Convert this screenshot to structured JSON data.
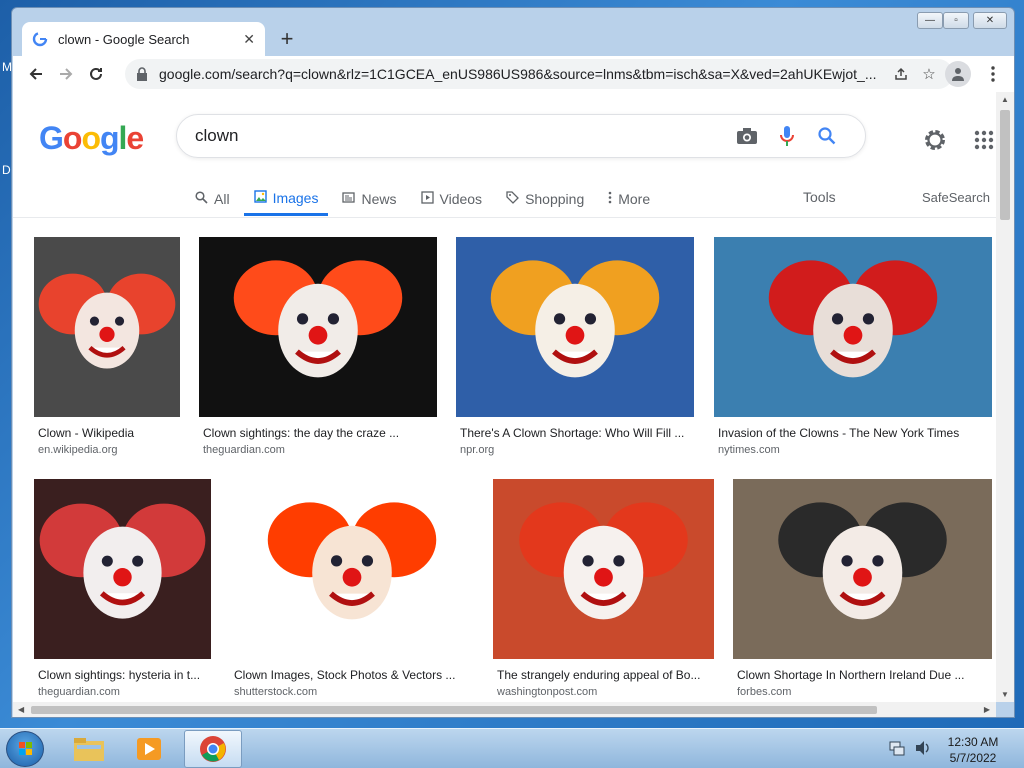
{
  "desktop": {
    "left_labels": [
      "M",
      "D"
    ]
  },
  "browser": {
    "window_controls": {
      "minimize": "—",
      "maximize": "▫",
      "close": "✕"
    },
    "tab": {
      "title": "clown - Google Search",
      "close": "✕"
    },
    "new_tab": "+",
    "url": "google.com/search?q=clown&rlz=1C1GCEA_enUS986US986&source=lnms&tbm=isch&sa=X&ved=2ahUKEwjot_..."
  },
  "google": {
    "logo": [
      {
        "ch": "G",
        "color": "#4285F4"
      },
      {
        "ch": "o",
        "color": "#EA4335"
      },
      {
        "ch": "o",
        "color": "#FBBC05"
      },
      {
        "ch": "g",
        "color": "#4285F4"
      },
      {
        "ch": "l",
        "color": "#34A853"
      },
      {
        "ch": "e",
        "color": "#EA4335"
      }
    ],
    "query": "clown",
    "tabs": [
      {
        "label": "All",
        "icon": "search-icon",
        "active": false
      },
      {
        "label": "Images",
        "icon": "image-icon",
        "active": true
      },
      {
        "label": "News",
        "icon": "news-icon",
        "active": false
      },
      {
        "label": "Videos",
        "icon": "video-icon",
        "active": false
      },
      {
        "label": "Shopping",
        "icon": "tag-icon",
        "active": false
      },
      {
        "label": "More",
        "icon": "more-vert-icon",
        "active": false
      }
    ],
    "tools": "Tools",
    "safesearch": "SafeSearch"
  },
  "results": [
    {
      "caption": "Clown - Wikipedia",
      "source": "en.wikipedia.org",
      "bg": "#4a4a4a",
      "face": "#f3e6e0",
      "hair": "#e8432d"
    },
    {
      "caption": "Clown sightings: the day the craze ...",
      "source": "theguardian.com",
      "bg": "#111111",
      "face": "#f1ece8",
      "hair": "#ff4b1a"
    },
    {
      "caption": "There's A Clown Shortage: Who Will Fill ...",
      "source": "npr.org",
      "bg": "#2f5fa8",
      "face": "#f5efe6",
      "hair": "#f0a020"
    },
    {
      "caption": "Invasion of the Clowns - The New York Times",
      "source": "nytimes.com",
      "bg": "#3b7fb0",
      "face": "#e8ded8",
      "hair": "#d11c1c"
    },
    {
      "caption": "Clown sightings: hysteria in t...",
      "source": "theguardian.com",
      "bg": "#3a1f1f",
      "face": "#f2eeee",
      "hair": "#d23a3a"
    },
    {
      "caption": "Clown Images, Stock Photos & Vectors ...",
      "source": "shutterstock.com",
      "bg": "#ffffff",
      "face": "#f7e4d4",
      "hair": "#ff3d00"
    },
    {
      "caption": "The strangely enduring appeal of Bo...",
      "source": "washingtonpost.com",
      "bg": "#c94a2c",
      "face": "#f6f1ee",
      "hair": "#e3381c"
    },
    {
      "caption": "Clown Shortage In Northern Ireland Due ...",
      "source": "forbes.com",
      "bg": "#7a6b5a",
      "face": "#f3ebe6",
      "hair": "#2a2a2a"
    }
  ],
  "taskbar": {
    "time": "12:30 AM",
    "date": "5/7/2022"
  }
}
